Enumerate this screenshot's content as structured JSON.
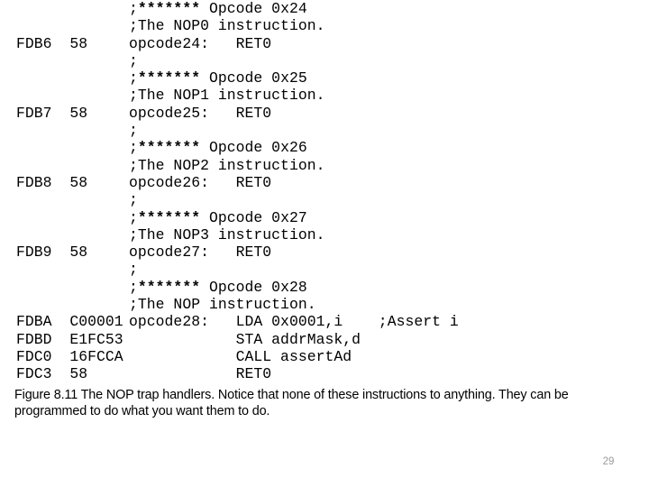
{
  "listing": {
    "lines": [
      {
        "addr": "",
        "src": ";******* Opcode 0x24"
      },
      {
        "addr": "",
        "src": ";The NOP0 instruction."
      },
      {
        "addr": "FDB6  58",
        "src": "opcode24:   RET0"
      },
      {
        "addr": "",
        "src": ";"
      },
      {
        "addr": "",
        "src": ";******* Opcode 0x25"
      },
      {
        "addr": "",
        "src": ";The NOP1 instruction."
      },
      {
        "addr": "FDB7  58",
        "src": "opcode25:   RET0"
      },
      {
        "addr": "",
        "src": ";"
      },
      {
        "addr": "",
        "src": ";******* Opcode 0x26"
      },
      {
        "addr": "",
        "src": ";The NOP2 instruction."
      },
      {
        "addr": "FDB8  58",
        "src": "opcode26:   RET0"
      },
      {
        "addr": "",
        "src": ";"
      },
      {
        "addr": "",
        "src": ";******* Opcode 0x27"
      },
      {
        "addr": "",
        "src": ";The NOP3 instruction."
      },
      {
        "addr": "FDB9  58",
        "src": "opcode27:   RET0"
      },
      {
        "addr": "",
        "src": ";"
      },
      {
        "addr": "",
        "src": ";******* Opcode 0x28"
      },
      {
        "addr": "",
        "src": ";The NOP instruction."
      },
      {
        "addr": "FDBA  C00001",
        "src": "opcode28:   LDA 0x0001,i    ;Assert i"
      },
      {
        "addr": "FDBD  E1FC53",
        "src": "            STA addrMask,d"
      },
      {
        "addr": "FDC0  16FCCA",
        "src": "            CALL assertAd"
      },
      {
        "addr": "FDC3  58",
        "src": "            RET0"
      }
    ]
  },
  "caption": {
    "line1": "Figure 8.11  The NOP trap handlers. Notice that none of these instructions to anything. They can be",
    "line2": "programmed to do what you want them to do."
  },
  "footer": {
    "page_number": "29"
  }
}
